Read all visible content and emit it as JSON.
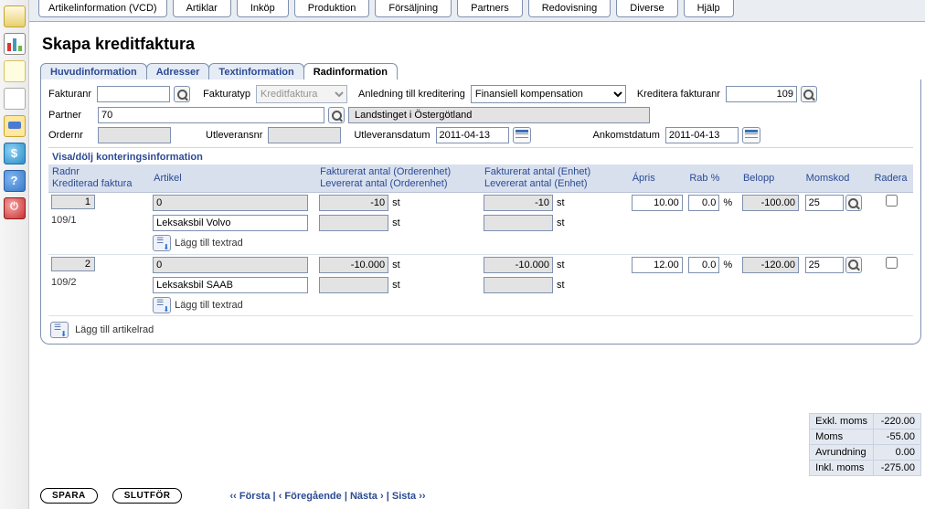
{
  "menu": [
    "Artikelinformation (VCD)",
    "Artiklar",
    "Inköp",
    "Produktion",
    "Försäljning",
    "Partners",
    "Redovisning",
    "Diverse",
    "Hjälp"
  ],
  "title": "Skapa kreditfaktura",
  "tabs": [
    "Huvudinformation",
    "Adresser",
    "Textinformation",
    "Radinformation"
  ],
  "activeTab": 3,
  "form": {
    "fakturanr_lbl": "Fakturanr",
    "fakturanr": "",
    "fakturatyp_lbl": "Fakturatyp",
    "fakturatyp": "Kreditfaktura",
    "anledning_lbl": "Anledning till kreditering",
    "anledning": "Finansiell kompensation",
    "kreditera_lbl": "Kreditera fakturanr",
    "kreditera": "109",
    "partner_lbl": "Partner",
    "partner": "70",
    "partner_name": "Landstinget i Östergötland",
    "ordernr_lbl": "Ordernr",
    "ordernr": "",
    "utlevnr_lbl": "Utleveransnr",
    "utlevnr": "",
    "utlevdat_lbl": "Utleveransdatum",
    "utlevdat": "2011-04-13",
    "ankdat_lbl": "Ankomstdatum",
    "ankdat": "2011-04-13"
  },
  "toggle": "Visa/dölj konteringsinformation",
  "headers": {
    "radnr": "Radnr",
    "kredfak": "Krediterad faktura",
    "artikel": "Artikel",
    "fakt_order": "Fakturerat antal (Orderenhet)",
    "lev_order": "Levererat antal (Orderenhet)",
    "fakt_enh": "Fakturerat antal (Enhet)",
    "lev_enh": "Levererat antal (Enhet)",
    "apris": "Ápris",
    "rab": "Rab %",
    "belopp": "Belopp",
    "momskod": "Momskod",
    "radera": "Radera"
  },
  "rows": [
    {
      "nr": "1",
      "kred": "109/1",
      "art_code": "0",
      "art_name": "Leksaksbil Volvo",
      "fakt_o": "-10",
      "lev_o": "",
      "unit_o": "st",
      "fakt_e": "-10",
      "lev_e": "",
      "unit_e": "st",
      "apris": "10.00",
      "rab": "0.0",
      "belopp": "-100.00",
      "moms": "25"
    },
    {
      "nr": "2",
      "kred": "109/2",
      "art_code": "0",
      "art_name": "Leksaksbil SAAB",
      "fakt_o": "-10.000",
      "lev_o": "",
      "unit_o": "st",
      "fakt_e": "-10.000",
      "lev_e": "",
      "unit_e": "st",
      "apris": "12.00",
      "rab": "0.0",
      "belopp": "-120.00",
      "moms": "25"
    }
  ],
  "pct": "%",
  "add_textrad": "Lägg till textrad",
  "add_artikelrad": "Lägg till artikelrad",
  "totals": {
    "exkl_l": "Exkl. moms",
    "exkl": "-220.00",
    "moms_l": "Moms",
    "moms": "-55.00",
    "avr_l": "Avrundning",
    "avr": "0.00",
    "inkl_l": "Inkl. moms",
    "inkl": "-275.00"
  },
  "buttons": {
    "spara": "SPARA",
    "slutfor": "SLUTFÖR"
  },
  "pager": {
    "first": "‹‹ Första",
    "prev": "‹ Föregående",
    "next": "Nästa ›",
    "last": "Sista ››",
    "sep": " | "
  }
}
